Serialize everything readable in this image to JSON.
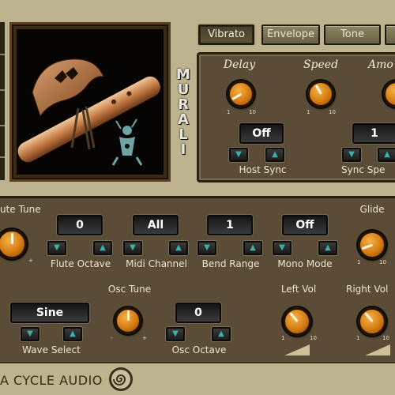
{
  "brand": {
    "footer_text": "A CYCLE AUDIO",
    "logo_icon": "spiral-logo-icon"
  },
  "title_vertical": [
    "M",
    "U",
    "R",
    "A",
    "L",
    "I"
  ],
  "tabs": [
    {
      "label": "Vibrato",
      "active": true
    },
    {
      "label": "Envelope",
      "active": false
    },
    {
      "label": "Tone",
      "active": false
    }
  ],
  "vibrato": {
    "delay_label": "Delay",
    "speed_label": "Speed",
    "amount_label": "Amo",
    "host_sync_value": "Off",
    "host_sync_label": "Host Sync",
    "sync_speed_value": "1",
    "sync_speed_label": "Sync Spe",
    "knob_scale": [
      "1",
      "10"
    ]
  },
  "main": {
    "flute_tune_label": "ute Tune",
    "flute_octave_value": "0",
    "flute_octave_label": "Flute Octave",
    "midi_channel_value": "All",
    "midi_channel_label": "Midi Channel",
    "bend_range_value": "1",
    "bend_range_label": "Bend Range",
    "mono_mode_value": "Off",
    "mono_mode_label": "Mono Mode",
    "glide_label": "Glide",
    "osc_tune_label": "Osc Tune",
    "wave_select_value": "Sine",
    "wave_select_label": "Wave Select",
    "osc_octave_value": "0",
    "osc_octave_label": "Osc Octave",
    "left_vol_label": "Left Vol",
    "right_vol_label": "Right Vol",
    "knob_scale": [
      "1",
      "10"
    ],
    "minus_sign": "-",
    "plus_sign": "+"
  },
  "arrows": {
    "down": "▼",
    "up": "▲"
  },
  "colors": {
    "knob_orange": "#d57b12",
    "lcd_text": "#ffffff",
    "arrow_teal": "#3ab0a8",
    "panel_brown": "#5b4c37"
  }
}
